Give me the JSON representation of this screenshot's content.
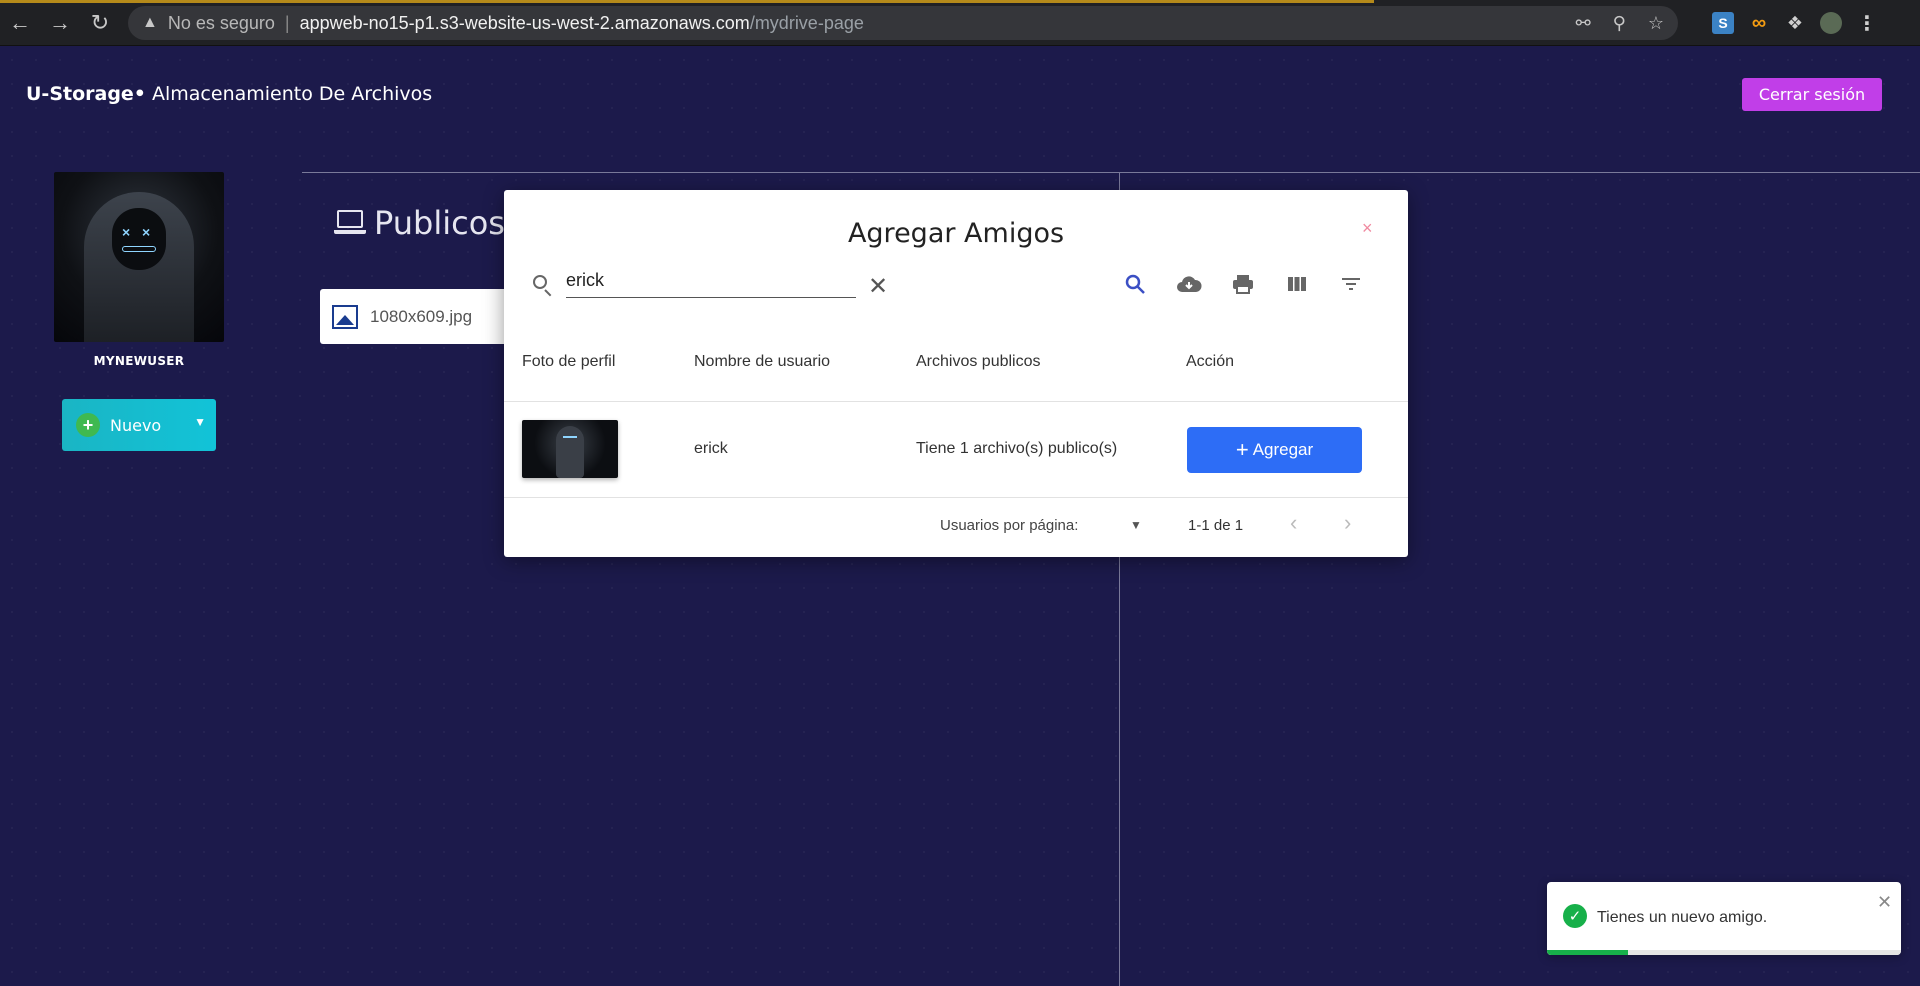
{
  "browser": {
    "insecure_label": "No es seguro",
    "url_host": "appweb-no15-p1.s3-website-us-west-2.amazonaws.com",
    "url_path": "/mydrive-page"
  },
  "header": {
    "brand": "U-Storage•",
    "subtitle": " Almacenamiento De Archivos",
    "logout_label": "Cerrar sesión"
  },
  "sidebar": {
    "username": "MYNEWUSER",
    "new_button_label": "Nuevo"
  },
  "main": {
    "section_title": "Publicos",
    "files": [
      {
        "name": "1080x609.jpg"
      }
    ]
  },
  "modal": {
    "title": "Agregar Amigos",
    "close_icon": "×",
    "search": {
      "value": "erick"
    },
    "toolbar": [
      "search-icon",
      "download-icon",
      "print-icon",
      "columns-icon",
      "filter-icon"
    ],
    "columns": [
      "Foto de perfil",
      "Nombre de usuario",
      "Archivos publicos",
      "Acción"
    ],
    "rows": [
      {
        "username": "erick",
        "files": "Tiene 1 archivo(s) publico(s)",
        "action": "Agregar"
      }
    ],
    "footer": {
      "rows_per_page_label": "Usuarios por página:",
      "range": "1-1 de 1"
    }
  },
  "toast": {
    "message": "Tienes un nuevo amigo.",
    "progress": 0.23,
    "status_color": "#17b04a"
  },
  "colors": {
    "background": "#1c1a4b",
    "logout": "#c13ee8",
    "new_button": "#12c3d8",
    "add_button": "#2d6df6"
  }
}
